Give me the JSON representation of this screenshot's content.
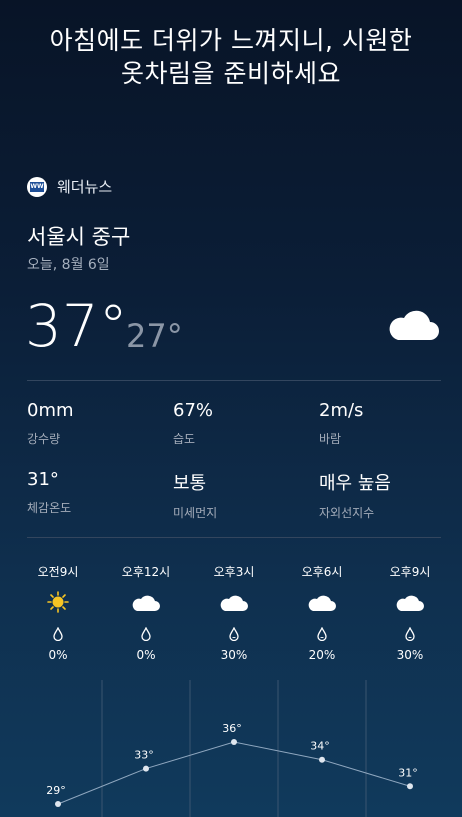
{
  "headline": {
    "line1": "아침에도 더위가 느껴지니, 시원한",
    "line2": "옷차림을 준비하세요"
  },
  "brand": {
    "name": "웨더뉴스",
    "logo_text": "WW"
  },
  "location": "서울시 중구",
  "date": "오늘, 8월 6일",
  "current": {
    "temp": "37°",
    "low": "27°",
    "icon": "cloud-icon"
  },
  "stats": [
    {
      "value": "0mm",
      "label": "강수량"
    },
    {
      "value": "67%",
      "label": "습도"
    },
    {
      "value": "2m/s",
      "label": "바람"
    },
    {
      "value": "31°",
      "label": "체감온도"
    },
    {
      "value": "보통",
      "label": "미세먼지"
    },
    {
      "value": "매우 높음",
      "label": "자외선지수"
    }
  ],
  "hourly": [
    {
      "time": "오전9시",
      "icon": "sun-icon",
      "precip": "0%",
      "temp": 29,
      "temp_label": "29°"
    },
    {
      "time": "오후12시",
      "icon": "cloud-icon",
      "precip": "0%",
      "temp": 33,
      "temp_label": "33°"
    },
    {
      "time": "오후3시",
      "icon": "cloud-icon",
      "precip": "30%",
      "temp": 36,
      "temp_label": "36°"
    },
    {
      "time": "오후6시",
      "icon": "cloud-icon",
      "precip": "20%",
      "temp": 34,
      "temp_label": "34°"
    },
    {
      "time": "오후9시",
      "icon": "cloud-icon",
      "precip": "30%",
      "temp": 31,
      "temp_label": "31°"
    }
  ],
  "colors": {
    "sun": "#f7c524",
    "graph_line": "#8fa7bf",
    "grid_line": "#3a5570",
    "point": "#dfe6ee"
  }
}
